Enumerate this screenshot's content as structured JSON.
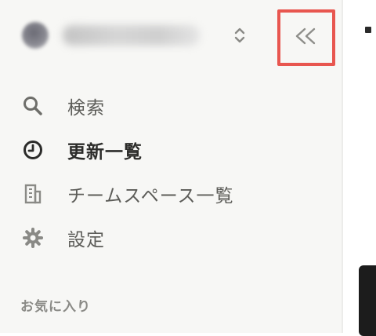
{
  "sidebar": {
    "nav": [
      {
        "label": "検索",
        "icon": "search-icon"
      },
      {
        "label": "更新一覧",
        "icon": "clock-icon",
        "active": true
      },
      {
        "label": "チームスペース一覧",
        "icon": "building-icon"
      },
      {
        "label": "設定",
        "icon": "gear-icon"
      }
    ],
    "favorites_title": "お気に入り"
  },
  "colors": {
    "sidebar_bg": "#f7f7f5",
    "highlight_border": "#e8564f",
    "text": "#5c5c58",
    "active_text": "#2c2c2a"
  }
}
